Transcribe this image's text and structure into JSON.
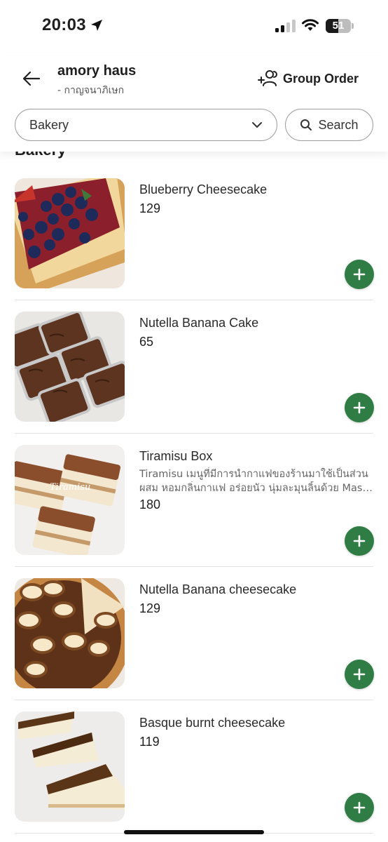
{
  "status_bar": {
    "time": "20:03",
    "battery_level": "51",
    "icons": [
      "location-arrow-icon",
      "signal-icon",
      "wifi-icon",
      "battery-icon"
    ]
  },
  "header": {
    "store_name": "amory haus",
    "store_location": "- กาญจนาภิเษก",
    "group_order_label": "Group Order",
    "category_selected": "Bakery",
    "search_label": "Search"
  },
  "section": {
    "title": "Bakery"
  },
  "items": [
    {
      "name": "Blueberry Cheesecake",
      "description": [],
      "price": "129"
    },
    {
      "name": "Nutella Banana Cake",
      "description": [],
      "price": "65"
    },
    {
      "name": "Tiramisu Box",
      "description": [
        "Tiramisu เมนูที่มีการนำกาแฟของร้านมาใช้เป็นส่วน",
        "ผสม หอมกลิ่นกาแฟ อร่อยนัว นุ่มละมุนลิ้นด้วย Mascarpone"
      ],
      "price": "180",
      "image_text": "Tiramisu"
    },
    {
      "name": "Nutella Banana cheesecake",
      "description": [],
      "price": "129"
    },
    {
      "name": "Basque burnt cheesecake",
      "description": [],
      "price": "119"
    }
  ],
  "colors": {
    "accent_green": "#2f7d45",
    "border_gray": "#9e9e9e"
  }
}
